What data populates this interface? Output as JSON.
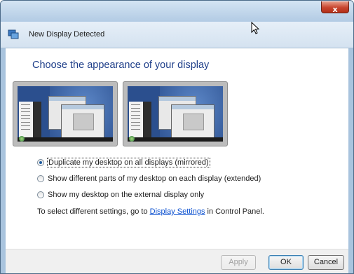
{
  "window": {
    "title": "New Display Detected",
    "close_label": "x"
  },
  "main": {
    "heading": "Choose the appearance of your display",
    "previews": [
      {
        "mode": "mirrored"
      },
      {
        "mode": "mirrored"
      }
    ],
    "options": [
      {
        "label": "Duplicate my desktop on all displays (mirrored)",
        "selected": true
      },
      {
        "label": "Show different parts of my desktop on each display (extended)",
        "selected": false
      },
      {
        "label": "Show my desktop on the external display only",
        "selected": false
      }
    ],
    "hint": {
      "prefix": "To select different settings, go to ",
      "link": "Display Settings",
      "suffix": " in Control Panel."
    }
  },
  "footer": {
    "apply_label": "Apply",
    "ok_label": "OK",
    "cancel_label": "Cancel"
  },
  "colors": {
    "heading": "#1e3e89",
    "link": "#0b50d0",
    "close": "#c8452e"
  }
}
